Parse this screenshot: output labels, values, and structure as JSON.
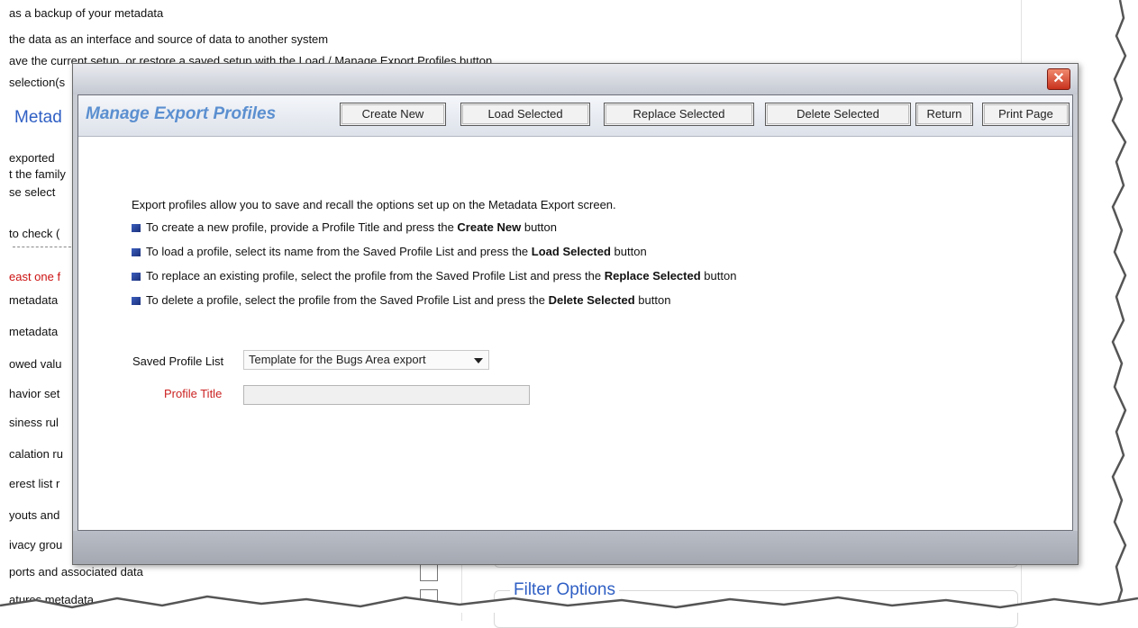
{
  "background": {
    "top_lines": [
      "as a backup of your metadata",
      "the data as an interface and source of data to another system",
      "ave the current setup, or restore a saved setup with the Load / Manage Export Profiles button",
      "selection(s"
    ],
    "section_heading": "Metad",
    "left_items": [
      "exported",
      "t the family",
      "se select",
      "to check (",
      "east one f",
      "metadata",
      "metadata",
      "owed valu",
      "havior set",
      "siness rul",
      "calation ru",
      "erest list r",
      "youts and",
      "ivacy grou",
      "ports and associated data",
      "atures metadata"
    ],
    "filter_legend": "Filter Options"
  },
  "dialog": {
    "close_label": "✕",
    "title": "Manage Export Profiles",
    "buttons": {
      "create_new": "Create New",
      "load_selected": "Load Selected",
      "replace_selected": "Replace Selected",
      "delete_selected": "Delete Selected",
      "return": "Return",
      "print_page": "Print Page"
    },
    "intro": "Export profiles allow you to save and recall the options set up on the Metadata Export screen.",
    "bullets": [
      {
        "pre": "To create a new profile, provide a Profile Title and press the ",
        "bold": "Create New",
        "post": " button"
      },
      {
        "pre": "To load a profile, select its name from the Saved Profile List and press the ",
        "bold": "Load Selected",
        "post": " button"
      },
      {
        "pre": "To replace an existing profile, select the profile from the Saved Profile List and press the ",
        "bold": "Replace Selected",
        "post": " button"
      },
      {
        "pre": "To delete a profile, select the profile from the Saved Profile List and press the ",
        "bold": "Delete Selected",
        "post": " button"
      }
    ],
    "saved_profile_label": "Saved Profile List",
    "saved_profile_value": "Template for the Bugs Area export",
    "profile_title_label": "Profile Title",
    "profile_title_value": ""
  },
  "colors": {
    "accent_blue": "#5b8fd0",
    "required_red": "#cc2222",
    "close_red": "#c8321d"
  }
}
